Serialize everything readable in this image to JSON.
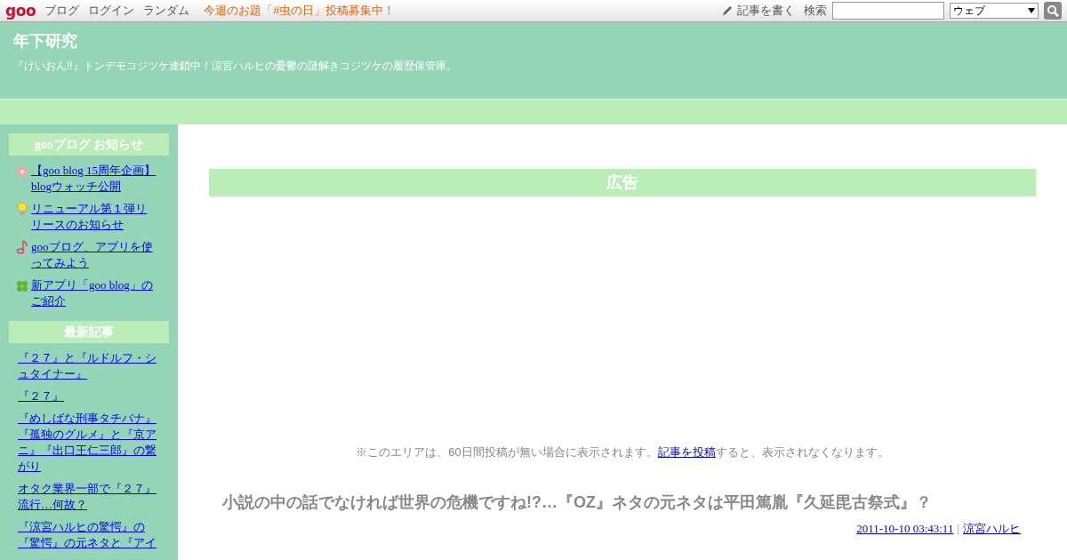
{
  "topbar": {
    "logo": "goo",
    "links": [
      "ブログ",
      "ログイン",
      "ランダム"
    ],
    "notice": "今週のお題「#虫の日」投稿募集中！",
    "write": "記事を書く",
    "search_label": "検索",
    "search_scope": "ウェブ"
  },
  "header": {
    "title": "年下研究",
    "description": "『けいおん!!』トンデモコジツケ連鎖中！涼宮ハルヒの憂鬱の謎解きコジツケの履歴保管庫。"
  },
  "sidebar": [
    {
      "heading": "gooブログ お知らせ",
      "items": [
        {
          "kind": "flower",
          "text": "【goo blog 15周年企画】blogウォッチ公開"
        },
        {
          "kind": "bulb",
          "text": "リニューアル第１弾リリースのお知らせ"
        },
        {
          "kind": "note",
          "text": "gooブログ、アプリを使ってみよう"
        },
        {
          "kind": "clover",
          "text": "新アプリ「goo blog」のご紹介"
        }
      ]
    },
    {
      "heading": "最新記事",
      "items": [
        {
          "kind": "plain",
          "text": "『２７』と『ルドルフ・シュタイナー』"
        },
        {
          "kind": "plain",
          "text": "『２７』"
        },
        {
          "kind": "plain",
          "text": "『めしばな刑事タチバナ』『孤独のグルメ』と『京アニ』『出口王仁三郎』の繋がり"
        },
        {
          "kind": "plain",
          "text": "オタク業界一部で『２７』流行…何故？"
        },
        {
          "kind": "plain",
          "text": "『涼宮ハルヒの驚愕』の『驚愕』の元ネタと『アイ"
        }
      ]
    }
  ],
  "ad": {
    "heading": "広告",
    "notice_before": "※このエリアは、60日間投稿が無い場合に表示されます。",
    "notice_link": "記事を投稿",
    "notice_after": "すると、表示されなくなります。"
  },
  "post": {
    "title": "小説の中の話でなければ世界の危機ですね!?…『OZ』ネタの元ネタは平田篤胤『久延毘古祭式』？",
    "date": "2011-10-10 03:43:11",
    "separator": "|",
    "author": "涼宮ハルヒ"
  }
}
